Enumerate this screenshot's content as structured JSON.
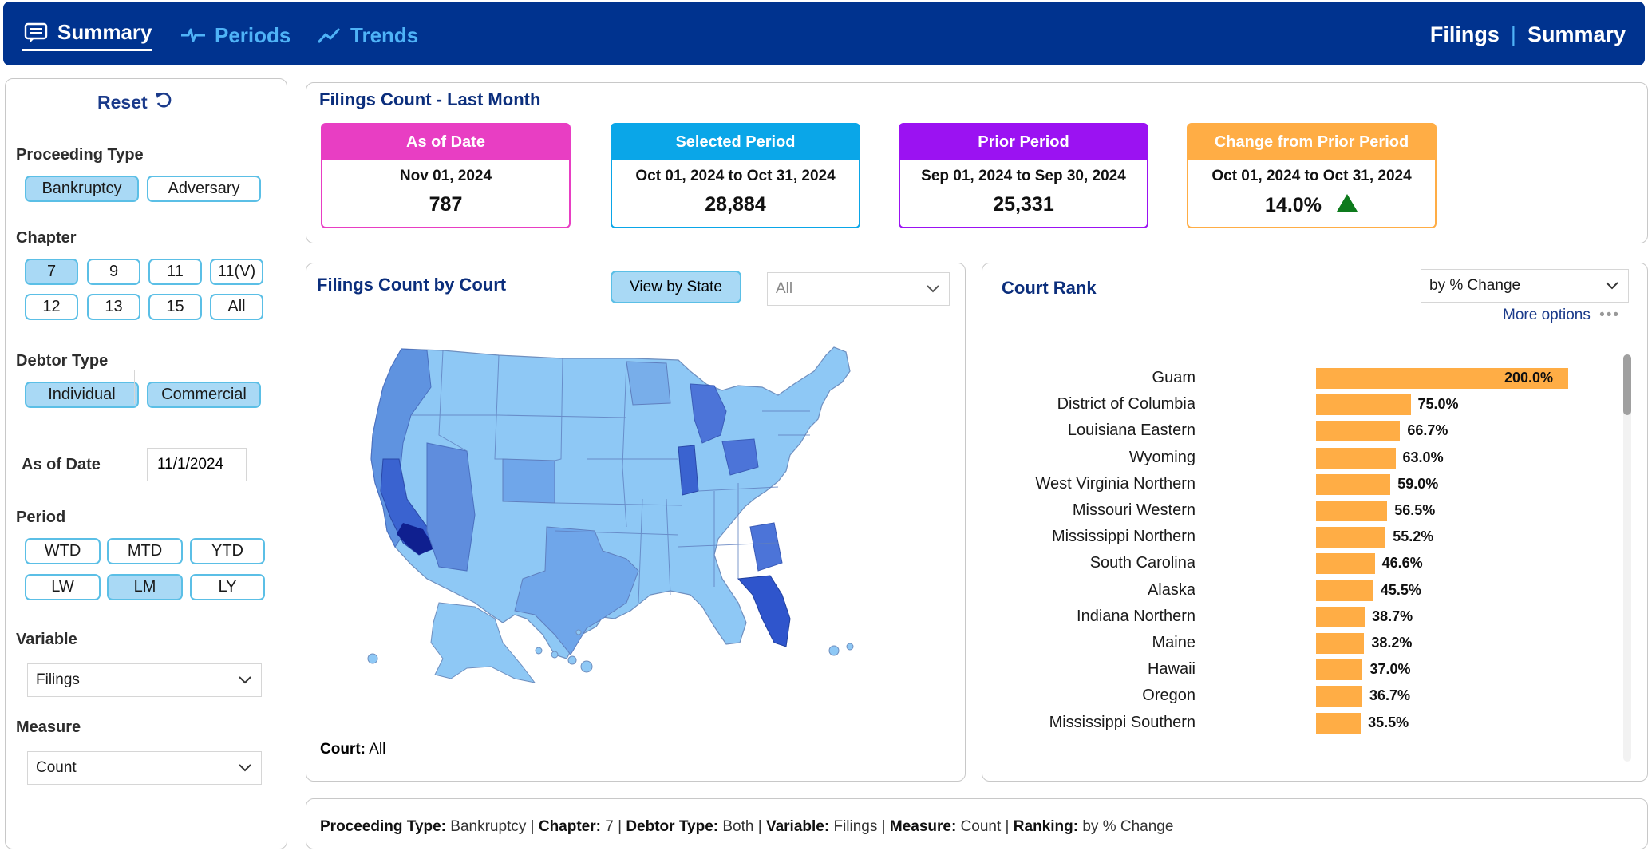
{
  "nav": {
    "tabs": [
      {
        "label": "Summary",
        "icon": "summary-icon"
      },
      {
        "label": "Periods",
        "icon": "periods-icon"
      },
      {
        "label": "Trends",
        "icon": "trends-icon"
      }
    ],
    "breadcrumb": {
      "section": "Filings",
      "separator": "|",
      "page": "Summary"
    }
  },
  "filters": {
    "reset_label": "Reset",
    "proceeding_type": {
      "label": "Proceeding Type",
      "options": [
        "Bankruptcy",
        "Adversary"
      ],
      "selected": "Bankruptcy"
    },
    "chapter": {
      "label": "Chapter",
      "options": [
        "7",
        "9",
        "11",
        "11(V)",
        "12",
        "13",
        "15",
        "All"
      ],
      "selected": "7"
    },
    "debtor_type": {
      "label": "Debtor Type",
      "options": [
        "Individual",
        "Commercial"
      ],
      "selected": [
        "Individual",
        "Commercial"
      ]
    },
    "as_of_date": {
      "label": "As of Date",
      "value": "11/1/2024"
    },
    "period": {
      "label": "Period",
      "options": [
        "WTD",
        "MTD",
        "YTD",
        "LW",
        "LM",
        "LY"
      ],
      "selected": "LM"
    },
    "variable": {
      "label": "Variable",
      "value": "Filings"
    },
    "measure": {
      "label": "Measure",
      "value": "Count"
    }
  },
  "kpis": {
    "title": "Filings Count - Last Month",
    "cards": [
      {
        "header": "As of Date",
        "sub": "Nov 01, 2024",
        "value": "787",
        "color": "#e83ec3"
      },
      {
        "header": "Selected Period",
        "sub": "Oct 01, 2024 to Oct 31, 2024",
        "value": "28,884",
        "color": "#0aa6e8"
      },
      {
        "header": "Prior Period",
        "sub": "Sep 01, 2024 to Sep 30, 2024",
        "value": "25,331",
        "color": "#9b12f2"
      },
      {
        "header": "Change from Prior Period",
        "sub": "Oct 01, 2024 to Oct 31, 2024",
        "value": "14.0%",
        "color": "#ffad45",
        "trend": "up"
      }
    ]
  },
  "map_panel": {
    "title": "Filings Count by Court",
    "view_button": "View by State",
    "filter_value": "All",
    "court_label": "Court:",
    "court_value": "All"
  },
  "rank_panel": {
    "title": "Court Rank",
    "sort_value": "by % Change",
    "more_options": "More options",
    "accent_color": "#ffad45"
  },
  "chart_data": {
    "type": "bar",
    "orientation": "horizontal",
    "categories": [
      "Guam",
      "District of Columbia",
      "Louisiana Eastern",
      "Wyoming",
      "West Virginia Northern",
      "Missouri Western",
      "Mississippi Northern",
      "South Carolina",
      "Alaska",
      "Indiana Northern",
      "Maine",
      "Hawaii",
      "Oregon",
      "Mississippi Southern"
    ],
    "values": [
      200.0,
      75.0,
      66.7,
      63.0,
      59.0,
      56.5,
      55.2,
      46.6,
      45.5,
      38.7,
      38.2,
      37.0,
      36.7,
      35.5
    ],
    "labels": [
      "200.0%",
      "75.0%",
      "66.7%",
      "63.0%",
      "59.0%",
      "56.5%",
      "55.2%",
      "46.6%",
      "45.5%",
      "38.7%",
      "38.2%",
      "37.0%",
      "36.7%",
      "35.5%"
    ]
  },
  "footer": {
    "items": [
      {
        "k": "Proceeding Type:",
        "v": "Bankruptcy"
      },
      {
        "k": "Chapter:",
        "v": "7"
      },
      {
        "k": "Debtor Type:",
        "v": "Both"
      },
      {
        "k": "Variable:",
        "v": "Filings"
      },
      {
        "k": "Measure:",
        "v": "Count"
      },
      {
        "k": "Ranking:",
        "v": "by % Change"
      }
    ]
  }
}
